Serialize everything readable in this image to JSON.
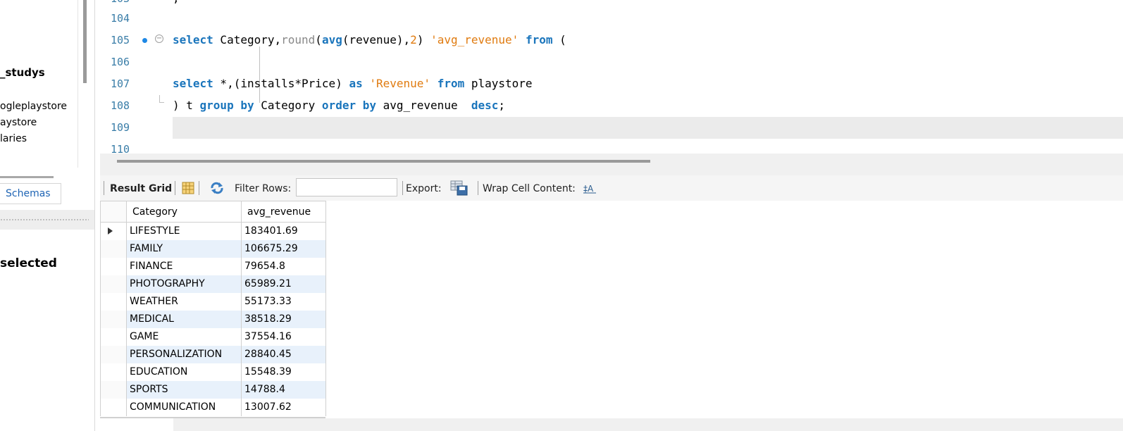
{
  "navigator": {
    "schema_name": "_studys",
    "tables": [
      "ogleplaystore",
      "aystore",
      "laries"
    ],
    "schemas_tab": "Schemas",
    "selection_text": "selected"
  },
  "editor": {
    "lines": [
      {
        "num": "104"
      },
      {
        "num": "105"
      },
      {
        "num": "106"
      },
      {
        "num": "107"
      },
      {
        "num": "108"
      },
      {
        "num": "109"
      },
      {
        "num": "110"
      }
    ],
    "top_partial": ";"
  },
  "toolbar": {
    "result_grid": "Result Grid",
    "filter_rows": "Filter Rows:",
    "filter_value": "",
    "export": "Export:",
    "wrap_cell": "Wrap Cell Content:"
  },
  "grid": {
    "columns": [
      "Category",
      "avg_revenue"
    ],
    "rows": [
      [
        "LIFESTYLE",
        "183401.69"
      ],
      [
        "FAMILY",
        "106675.29"
      ],
      [
        "FINANCE",
        "79654.8"
      ],
      [
        "PHOTOGRAPHY",
        "65989.21"
      ],
      [
        "WEATHER",
        "55173.33"
      ],
      [
        "MEDICAL",
        "38518.29"
      ],
      [
        "GAME",
        "37554.16"
      ],
      [
        "PERSONALIZATION",
        "28840.45"
      ],
      [
        "EDUCATION",
        "15548.39"
      ],
      [
        "SPORTS",
        "14788.4"
      ],
      [
        "COMMUNICATION",
        "13007.62"
      ]
    ]
  },
  "colors": {
    "keyword": "#1a75bc",
    "string": "#e07b10",
    "line_number": "#3b7ea8",
    "row_alt": "#e8f1fb"
  }
}
